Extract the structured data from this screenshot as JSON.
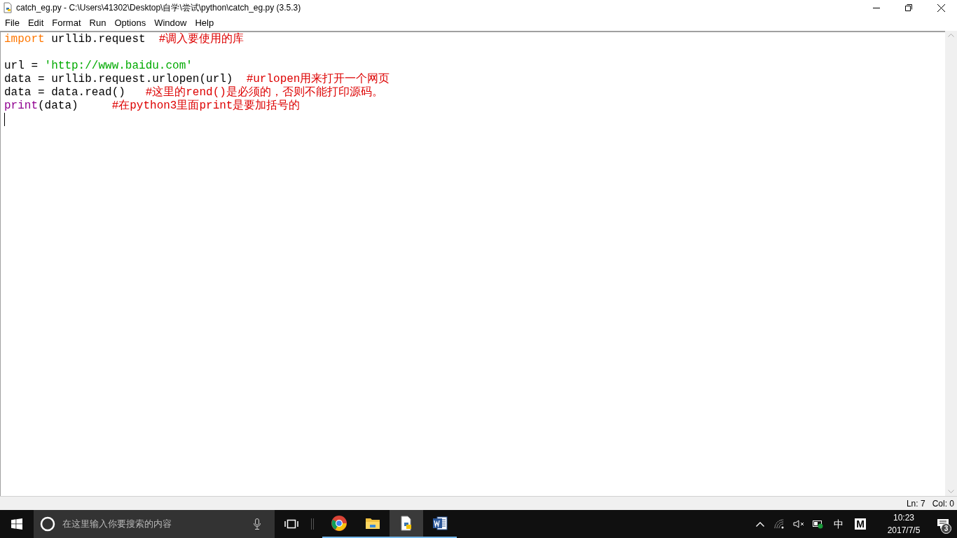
{
  "window": {
    "title": "catch_eg.py - C:\\Users\\41302\\Desktop\\自学\\尝试\\python\\catch_eg.py (3.5.3)"
  },
  "menu": [
    "File",
    "Edit",
    "Format",
    "Run",
    "Options",
    "Window",
    "Help"
  ],
  "editor": {
    "lines": [
      {
        "kind": "code",
        "cursor": false,
        "tokens": [
          {
            "kind": "keyword",
            "text": "import"
          },
          {
            "kind": "plain",
            "text": " urllib.request  "
          },
          {
            "kind": "comment",
            "text": "#调入要使用的库"
          }
        ]
      },
      {
        "kind": "blank",
        "cursor": false
      },
      {
        "kind": "code",
        "cursor": false,
        "tokens": [
          {
            "kind": "plain",
            "text": "url = "
          },
          {
            "kind": "string",
            "text": "'http://www.baidu.com'"
          }
        ]
      },
      {
        "kind": "code",
        "cursor": false,
        "tokens": [
          {
            "kind": "plain",
            "text": "data = urllib.request.urlopen(url)  "
          },
          {
            "kind": "comment",
            "text": "#urlopen用来打开一个网页"
          }
        ]
      },
      {
        "kind": "code",
        "cursor": false,
        "tokens": [
          {
            "kind": "plain",
            "text": "data = data.read()   "
          },
          {
            "kind": "comment",
            "text": "#这里的rend()是必须的，否则不能打印源码。"
          }
        ]
      },
      {
        "kind": "code",
        "cursor": false,
        "tokens": [
          {
            "kind": "builtin",
            "text": "print"
          },
          {
            "kind": "plain",
            "text": "(data)     "
          },
          {
            "kind": "comment",
            "text": "#在python3里面print是要加括号的"
          }
        ]
      },
      {
        "kind": "blank",
        "cursor": true
      }
    ]
  },
  "status_bar": {
    "line": "Ln: 7",
    "column": "Col: 0"
  },
  "taskbar": {
    "search": {
      "placeholder": "在这里输入你要搜索的内容"
    },
    "apps": [
      {
        "kind": "browser",
        "running": true,
        "selected": false
      },
      {
        "kind": "folder",
        "running": true,
        "selected": false
      },
      {
        "kind": "python",
        "running": true,
        "selected": true
      },
      {
        "kind": "word",
        "running": true,
        "selected": false
      }
    ],
    "tray": {
      "ime": "中",
      "ime_mode": "M",
      "time": "10:23",
      "date": "2017/7/5",
      "notifications": "3"
    }
  }
}
